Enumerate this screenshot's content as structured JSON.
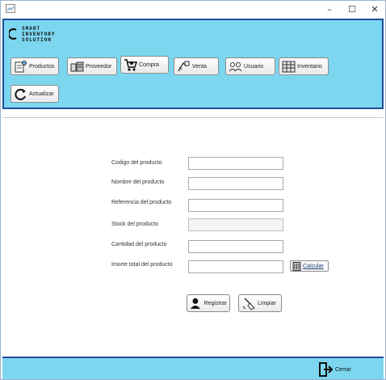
{
  "window": {
    "controls": {
      "minimize": "–",
      "maximize": "☐",
      "close": "✕"
    }
  },
  "logo": {
    "line1": "SMART",
    "line2": "INVENTORY",
    "line3": "SOLUTION"
  },
  "nav": {
    "productos": "Productos",
    "proveedor": "Proveedor",
    "compra": "Compra",
    "venta": "Venta",
    "usuario": "Usuario",
    "inventario": "Inventario",
    "actualizar": "Actualizar"
  },
  "form": {
    "codigo_label": "Codigo del producto",
    "nombre_label": "Nombre del producto",
    "referencia_label": "Referencia del producto",
    "stock_label": "Stock del producto",
    "cantidad_label": "Cantidad del producto",
    "importe_label": "Imorte total del producto",
    "codigo_value": "",
    "nombre_value": "",
    "referencia_value": "",
    "stock_value": "",
    "cantidad_value": "",
    "importe_value": "",
    "calcular": "Calcular"
  },
  "actions": {
    "registrar": "Registrar",
    "limpiar": "Limpiar"
  },
  "footer": {
    "cerrar": "Cerrar"
  },
  "colors": {
    "panel": "#7dd6ef",
    "border": "#1f4f9a"
  }
}
